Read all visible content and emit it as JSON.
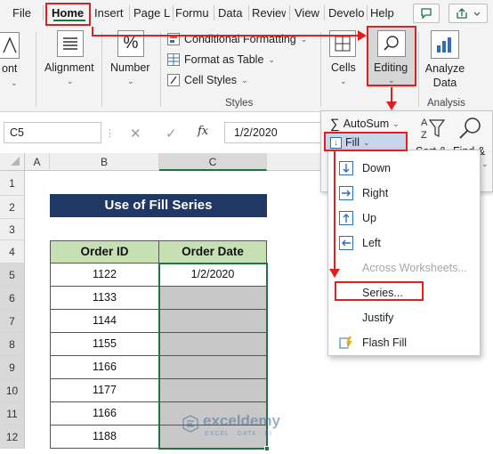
{
  "menu": {
    "tabs": [
      "File",
      "Home",
      "Insert",
      "Page L",
      "Formu",
      "Data",
      "Review",
      "View",
      "Develo",
      "Help"
    ],
    "active_tab": "Home"
  },
  "ribbon": {
    "font_partial": "ont",
    "alignment": "Alignment",
    "number": "Number",
    "percent_glyph": "%",
    "conditional_formatting": "Conditional Formatting",
    "format_as_table": "Format as Table",
    "cell_styles": "Cell Styles",
    "styles_group": "Styles",
    "cells": "Cells",
    "editing": "Editing",
    "analyze_line1": "Analyze",
    "analyze_line2": "Data",
    "analysis_group": "Analysis"
  },
  "formula_bar": {
    "name_box": "C5",
    "fx": "fx",
    "value": "1/2/2020"
  },
  "grid": {
    "columns": [
      "A",
      "B",
      "C"
    ],
    "rows": [
      "1",
      "2",
      "3",
      "4",
      "5",
      "6",
      "7",
      "8",
      "9",
      "10",
      "11",
      "12"
    ],
    "title": "Use of Fill Series",
    "headers": [
      "Order ID",
      "Order Date"
    ],
    "order_ids": [
      "1122",
      "1133",
      "1144",
      "1155",
      "1166",
      "1177",
      "1166",
      "1188"
    ],
    "first_date": "1/2/2020"
  },
  "editing_panel": {
    "autosum": "AutoSum",
    "fill": "Fill",
    "sort_partial": "Sort &",
    "find_partial": "Find &"
  },
  "fill_menu": {
    "items": [
      "Down",
      "Right",
      "Up",
      "Left",
      "Across Worksheets...",
      "Series...",
      "Justify",
      "Flash Fill"
    ]
  },
  "watermark": {
    "brand": "exceldemy",
    "tagline": "EXCEL · DATA · BI"
  },
  "colors": {
    "excel_green": "#217346",
    "title_fill": "#1f3864",
    "header_fill": "#c6e0b4",
    "selection_fill": "#c8c8c8",
    "annotation_red": "#e02020"
  }
}
